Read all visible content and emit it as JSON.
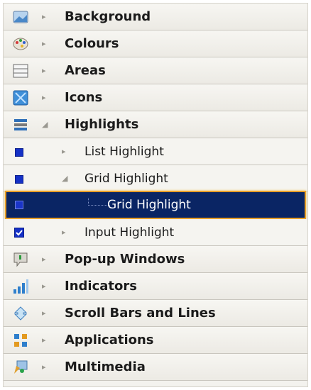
{
  "tree": {
    "items": [
      {
        "label": "Background",
        "icon": "background-icon",
        "arrow": "▸"
      },
      {
        "label": "Colours",
        "icon": "palette-icon",
        "arrow": "▸"
      },
      {
        "label": "Areas",
        "icon": "areas-icon",
        "arrow": "▸"
      },
      {
        "label": "Icons",
        "icon": "icons-icon",
        "arrow": "▸"
      },
      {
        "label": "Highlights",
        "icon": "highlights-icon",
        "arrow": "◢"
      },
      {
        "label": "List Highlight",
        "arrow": "▸"
      },
      {
        "label": "Grid Highlight",
        "arrow": "◢"
      },
      {
        "label": "Grid Highlight",
        "selected": true
      },
      {
        "label": "Input Highlight",
        "arrow": "▸"
      },
      {
        "label": "Pop-up Windows",
        "icon": "popup-icon",
        "arrow": "▸"
      },
      {
        "label": "Indicators",
        "icon": "signal-icon",
        "arrow": "▸"
      },
      {
        "label": "Scroll Bars and Lines",
        "icon": "scroll-icon",
        "arrow": "▸"
      },
      {
        "label": "Applications",
        "icon": "apps-icon",
        "arrow": "▸"
      },
      {
        "label": "Multimedia",
        "icon": "multimedia-icon",
        "arrow": "▸"
      }
    ]
  },
  "colors": {
    "selection_bg": "#0a2564",
    "selection_border": "#e9a02a",
    "swatch_blue": "#1531c6"
  }
}
